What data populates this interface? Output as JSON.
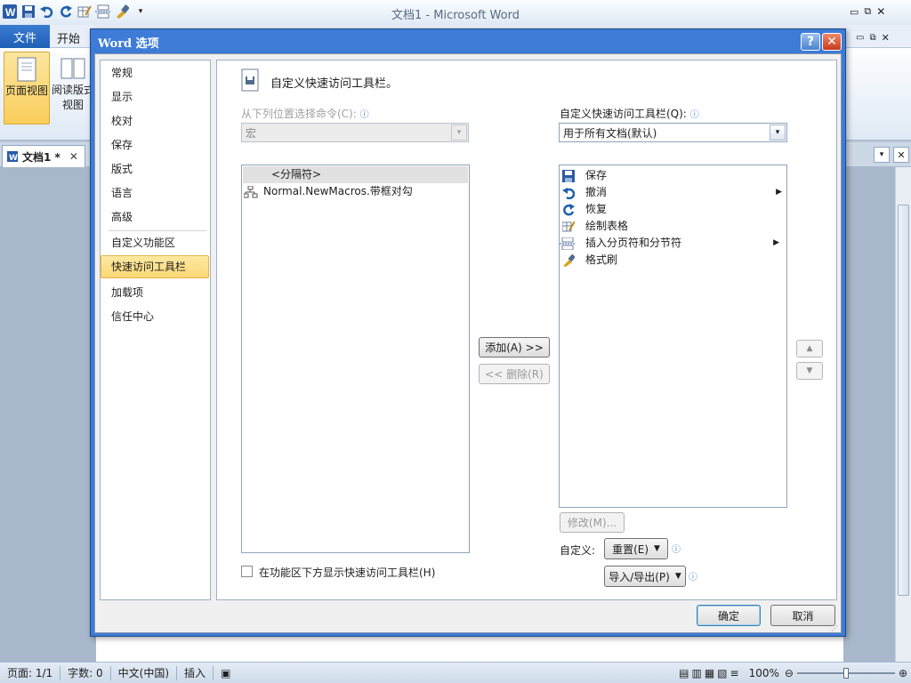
{
  "app": {
    "window_title": "文档1 - Microsoft Word",
    "file_tab": "文件",
    "home_tab": "开始",
    "ribbon_buttons": [
      "页面视图",
      "阅读版式\n视图"
    ],
    "doc_tab": "文档1 *",
    "status": {
      "page": "页面: 1/1",
      "words": "字数: 0",
      "lang": "中文(中国)",
      "mode": "插入",
      "zoom": "100%"
    }
  },
  "dialog": {
    "title": "Word 选项",
    "nav": {
      "items": [
        "常规",
        "显示",
        "校对",
        "保存",
        "版式",
        "语言",
        "高级",
        "自定义功能区",
        "快速访问工具栏",
        "加载项",
        "信任中心"
      ],
      "selected": "快速访问工具栏"
    },
    "header": "自定义快速访问工具栏。",
    "left": {
      "label": "从下列位置选择命令(C):",
      "select_value": "宏",
      "items": [
        "<分隔符>",
        "Normal.NewMacros.带框对勾"
      ]
    },
    "right": {
      "label": "自定义快速访问工具栏(Q):",
      "select_value": "用于所有文档(默认)",
      "items": [
        "保存",
        "撤消",
        "恢复",
        "绘制表格",
        "插入分页符和分节符",
        "格式刷"
      ]
    },
    "add_button": "添加(A) >>",
    "remove_button": "<< 删除(R)",
    "modify_button": "修改(M)...",
    "customize_label": "自定义:",
    "reset_button": "重置(E)",
    "import_export_button": "导入/导出(P)",
    "checkbox_label": "在功能区下方显示快速访问工具栏(H)",
    "ok_button": "确定",
    "cancel_button": "取消"
  }
}
